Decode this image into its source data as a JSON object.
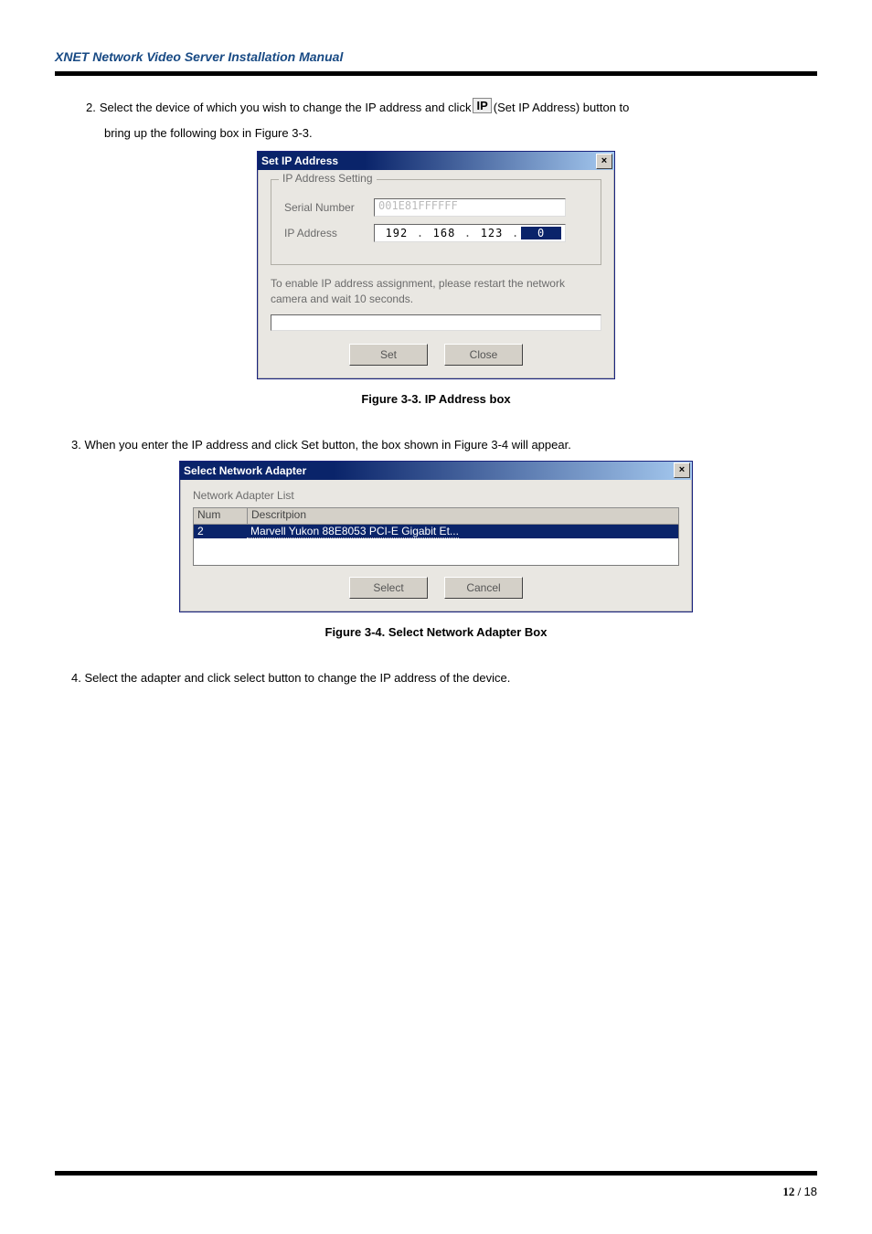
{
  "header_title": "XNET Network Video Server Installation Manual",
  "step2_num": "2.",
  "step2_text_a": "Select the device of which you wish to change the IP address and click ",
  "step2_ip_button_label": "IP",
  "step2_text_b": "(Set IP Address) button to",
  "step2_text_c": "bring up the following box in Figure 3-3.",
  "dialog1": {
    "title": "Set IP Address",
    "fieldset_legend": "IP Address Setting",
    "serial_label": "Serial Number",
    "serial_value": "001E81FFFFFF",
    "ip_label": "IP Address",
    "ip_oct1": "192",
    "ip_oct2": "168",
    "ip_oct3": "123",
    "ip_oct4": "0",
    "note": "To enable IP address assignment, please restart the network camera and wait  10 seconds.",
    "btn_set": "Set",
    "btn_close": "Close"
  },
  "fig1_caption": "Figure 3-3. IP Address box",
  "step3_num": "3.",
  "step3_text": "When you enter the IP address and click Set button, the box shown in Figure 3-4 will appear.",
  "dialog2": {
    "title": "Select Network Adapter",
    "list_label": "Network Adapter List",
    "col_num": "Num",
    "col_desc": "Descritpion",
    "row_num": "2",
    "row_desc": "Marvell Yukon 88E8053 PCI-E Gigabit Et...",
    "btn_select": "Select",
    "btn_cancel": "Cancel"
  },
  "fig2_caption": "Figure 3-4. Select Network Adapter Box",
  "step4_num": "4.",
  "step4_text": "Select the adapter and click select button to change the IP address of the device.",
  "footer_page_bold": "12 / ",
  "footer_page_total": "18"
}
